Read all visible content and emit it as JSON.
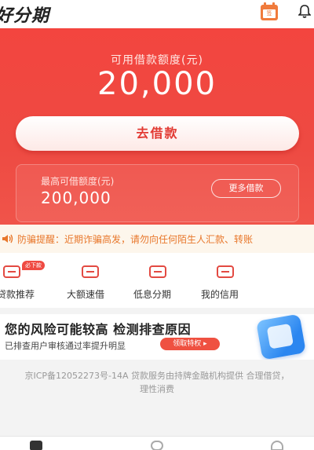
{
  "header": {
    "brand": "好分期",
    "calendar_icon": "calendar-icon",
    "calendar_text": "签",
    "bell_icon": "bell-icon"
  },
  "hero": {
    "label": "可用借款额度(元)",
    "amount": "20,000",
    "borrow_button": "去借款",
    "max_label": "最高可借额度(元)",
    "max_amount": "200,000",
    "more_button": "更多借款"
  },
  "notice": {
    "icon": "speaker-icon",
    "text": "防骗提醒：近期诈骗高发，请勿向任何陌生人汇款、转账"
  },
  "quick_menu": [
    {
      "label": "贷款推荐",
      "badge": "必下款",
      "icon": "loan-recommend-icon"
    },
    {
      "label": "大额速借",
      "icon": "quick-loan-icon"
    },
    {
      "label": "低息分期",
      "icon": "installment-icon"
    },
    {
      "label": "我的信用",
      "icon": "credit-icon"
    }
  ],
  "risk_banner": {
    "title": "您的风险可能较高 检测排查原因",
    "subtitle": "已排查用户审核通过率提升明显",
    "button": "领取特权 ▸",
    "icon": "shield-check-icon"
  },
  "footer": {
    "text": "京ICP备12052273号-14A 贷款服务由持牌金融机构提供 合理借贷，理性消费"
  },
  "tabbar": {
    "icons": [
      "wallet-icon",
      "discover-icon",
      "profile-icon"
    ]
  },
  "colors": {
    "brand_red": "#ee4a42",
    "notice_orange": "#e8772b"
  }
}
